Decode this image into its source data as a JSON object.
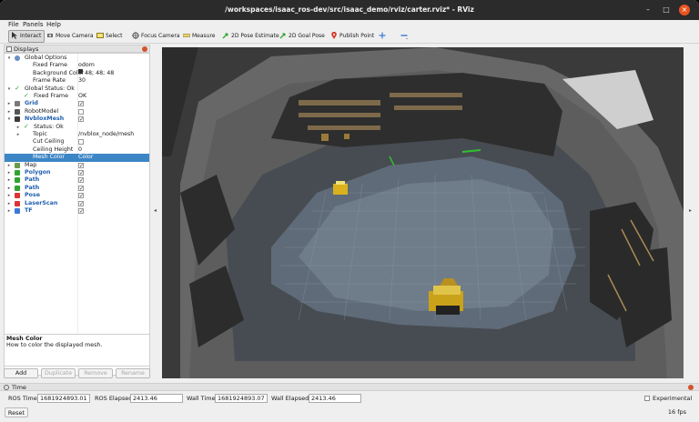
{
  "window": {
    "title": "/workspaces/isaac_ros-dev/src/isaac_demo/rviz/carter.rviz* - RViz",
    "minimize_glyph": "–",
    "maximize_glyph": "□",
    "close_glyph": "×"
  },
  "menu": [
    "File",
    "Panels",
    "Help"
  ],
  "toolbar": {
    "interact": "Interact",
    "move_camera": "Move Camera",
    "select": "Select",
    "focus_camera": "Focus Camera",
    "measure": "Measure",
    "pose_estimate": "2D Pose Estimate",
    "goal_pose": "2D Goal Pose",
    "publish_point": "Publish Point"
  },
  "displays": {
    "title": "Displays",
    "rows": [
      {
        "label": "Global Options",
        "value": "",
        "indent": 0,
        "arrow": "▾",
        "icon": "gear-icon"
      },
      {
        "label": "Fixed Frame",
        "value": "odom",
        "indent": 1,
        "arrow": "",
        "icon": ""
      },
      {
        "label": "Background Color",
        "value": "48; 48; 48",
        "indent": 1,
        "arrow": "",
        "icon": "",
        "swatch": true
      },
      {
        "label": "Frame Rate",
        "value": "30",
        "indent": 1,
        "arrow": "",
        "icon": ""
      },
      {
        "label": "Global Status: Ok",
        "value": "",
        "indent": 0,
        "arrow": "▾",
        "icon": "check-icon"
      },
      {
        "label": "Fixed Frame",
        "value": "OK",
        "indent": 1,
        "arrow": "",
        "icon": "check-icon"
      },
      {
        "label": "Grid",
        "value": "",
        "indent": 0,
        "arrow": "▸",
        "icon": "grid-icon",
        "blue": true,
        "check": "✓"
      },
      {
        "label": "RobotModel",
        "value": "",
        "indent": 0,
        "arrow": "▸",
        "icon": "robot-icon",
        "check": ""
      },
      {
        "label": "NvbloxMesh",
        "value": "",
        "indent": 0,
        "arrow": "▾",
        "icon": "mesh-icon",
        "blue": true,
        "check": "✓"
      },
      {
        "label": "Status: Ok",
        "value": "",
        "indent": 1,
        "arrow": "▸",
        "icon": "check-icon"
      },
      {
        "label": "Topic",
        "value": "/nvblox_node/mesh",
        "indent": 1,
        "arrow": "▸",
        "icon": ""
      },
      {
        "label": "Cut Ceiling",
        "value": "",
        "indent": 1,
        "arrow": "",
        "icon": "",
        "check": ""
      },
      {
        "label": "Ceiling Height",
        "value": "0",
        "indent": 1,
        "arrow": "",
        "icon": ""
      },
      {
        "label": "Mesh Color",
        "value": "Color",
        "indent": 1,
        "arrow": "",
        "icon": "",
        "selected": true
      },
      {
        "label": "Map",
        "value": "",
        "indent": 0,
        "arrow": "▸",
        "icon": "map-icon",
        "check": "✓"
      },
      {
        "label": "Polygon",
        "value": "",
        "indent": 0,
        "arrow": "▸",
        "icon": "polygon-icon",
        "blue": true,
        "check": "✓"
      },
      {
        "label": "Path",
        "value": "",
        "indent": 0,
        "arrow": "▸",
        "icon": "path-icon",
        "blue": true,
        "check": "✓"
      },
      {
        "label": "Path",
        "value": "",
        "indent": 0,
        "arrow": "▸",
        "icon": "path-icon",
        "blue": true,
        "check": "✓"
      },
      {
        "label": "Pose",
        "value": "",
        "indent": 0,
        "arrow": "▸",
        "icon": "pose-icon",
        "blue": true,
        "check": "✓"
      },
      {
        "label": "LaserScan",
        "value": "",
        "indent": 0,
        "arrow": "▸",
        "icon": "laser-icon",
        "blue": true,
        "check": "✓"
      },
      {
        "label": "TF",
        "value": "",
        "indent": 0,
        "arrow": "▸",
        "icon": "tf-icon",
        "blue": true,
        "check": "✓"
      }
    ],
    "help_title": "Mesh Color",
    "help_text": "How to color the displayed mesh.",
    "buttons": {
      "add": "Add",
      "duplicate": "Duplicate",
      "remove": "Remove",
      "rename": "Rename"
    }
  },
  "splitter": {
    "left_glyph": "◂",
    "right_glyph": "▸"
  },
  "time": {
    "title": "Time",
    "ros_time_label": "ROS Time:",
    "ros_time": "1681924893.01",
    "ros_elapsed_label": "ROS Elapsed:",
    "ros_elapsed": "2413.46",
    "wall_time_label": "Wall Time:",
    "wall_time": "1681924893.07",
    "wall_elapsed_label": "Wall Elapsed:",
    "wall_elapsed": "2413.46",
    "experimental_label": "Experimental",
    "reset": "Reset",
    "fps": "16 fps"
  },
  "colors": {
    "selection": "#3d86c6",
    "close_button": "#e95420",
    "viewport_background": "#303030"
  }
}
